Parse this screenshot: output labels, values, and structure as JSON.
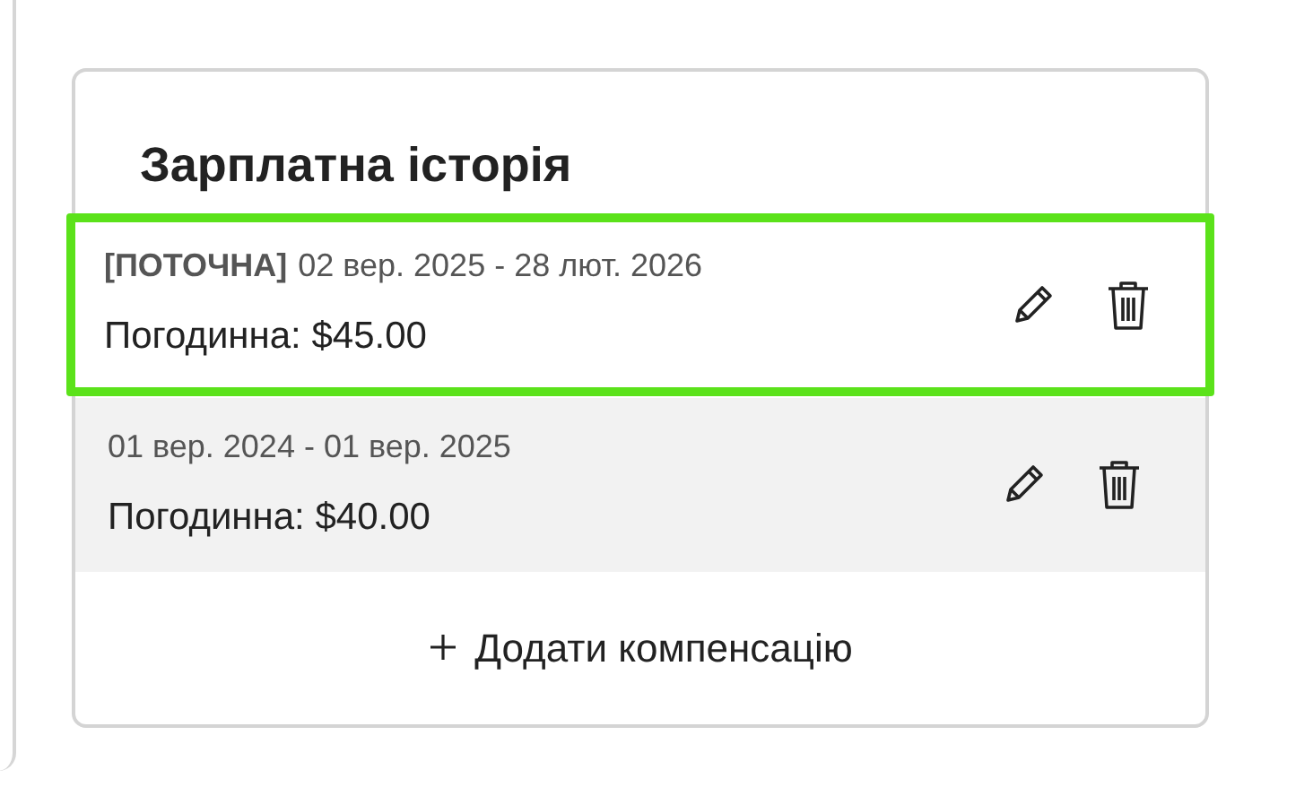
{
  "card": {
    "title": "Зарплатна історія",
    "entries": [
      {
        "badge": "[ПОТОЧНА]",
        "period": "02 вер. 2025 - 28 лют. 2026",
        "rate": "Погодинна: $45.00",
        "selected": true
      },
      {
        "period": "01 вер. 2024 - 01 вер. 2025",
        "rate": "Погодинна: $40.00",
        "selected": false
      }
    ],
    "add_button": "Додати компенсацію"
  }
}
